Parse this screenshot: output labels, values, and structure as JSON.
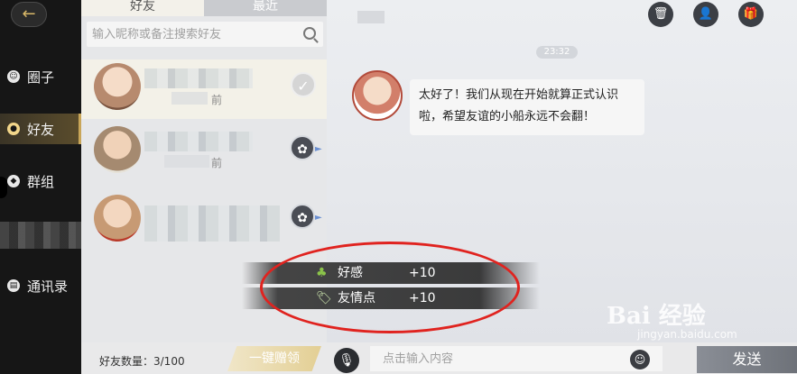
{
  "nav": {
    "items": [
      {
        "label": "圈子",
        "icon": "smile-icon"
      },
      {
        "label": "好友",
        "icon": "user-icon",
        "active": true
      },
      {
        "label": "群组",
        "icon": "group-icon"
      },
      {
        "label": "通讯录",
        "icon": "contacts-icon"
      }
    ]
  },
  "friends": {
    "tabs": [
      "好友",
      "最近"
    ],
    "search_placeholder": "输入昵称或备注搜索好友",
    "items": [
      {
        "ago": "前",
        "status": "check"
      },
      {
        "ago": "前",
        "status": "gift"
      },
      {
        "ago": "",
        "status": "gift"
      }
    ],
    "count_label": "好友数量：3/100",
    "gift_all_label": "一键赠领"
  },
  "chat": {
    "timestamp": "23:32",
    "message": "太好了！我们从现在开始就算正式认识啦，希望友谊的小船永远不会翻！",
    "input_placeholder": "点击输入内容",
    "send_label": "发送"
  },
  "toasts": [
    {
      "icon": "clover-icon",
      "label": "好感",
      "value": "+10"
    },
    {
      "icon": "tag-icon",
      "label": "友情点",
      "value": "+10"
    }
  ],
  "watermark": {
    "title": "Bai 经验",
    "sub": "jingyan.baidu.com"
  },
  "colors": {
    "accent_gold": "#c9a659",
    "highlight_red": "#e0231f",
    "nav_bg": "#161616"
  }
}
